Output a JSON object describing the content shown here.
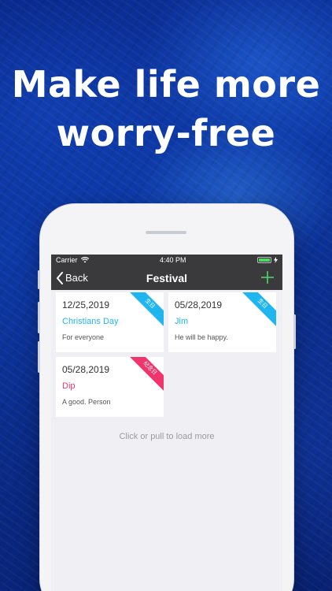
{
  "headline": {
    "line1": "Make life more",
    "line2": "worry-free"
  },
  "statusbar": {
    "carrier": "Carrier",
    "time": "4:40 PM"
  },
  "navbar": {
    "back_label": "Back",
    "title": "Festival"
  },
  "cards": [
    {
      "date": "12/25,2019",
      "title": "Christians Day",
      "description": "For everyone",
      "badge": "生日",
      "color": "#1fb6f0"
    },
    {
      "date": "05/28,2019",
      "title": "Jim",
      "description": "He will be happy.",
      "badge": "生日",
      "color": "#1fb6f0"
    },
    {
      "date": "05/28,2019",
      "title": "Dip",
      "description": "A  good. Person",
      "badge": "纪念日",
      "color": "#f0346c"
    }
  ],
  "load_more": "Click or pull to load more",
  "colors": {
    "accent_green": "#4cd964",
    "nav_bg": "#3a3a3c"
  }
}
